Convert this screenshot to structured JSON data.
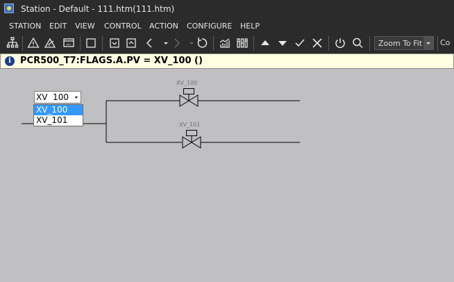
{
  "window": {
    "title": "Station - Default - 111.htm(111.htm)"
  },
  "menu": {
    "items": [
      "STATION",
      "EDIT",
      "VIEW",
      "CONTROL",
      "ACTION",
      "CONFIGURE",
      "HELP"
    ]
  },
  "toolbar": {
    "zoom_label": "Zoom To Fit",
    "cutoff_label": "Co",
    "icons": [
      "network-icon",
      "alarm-icon",
      "alarm-ack-icon",
      "message-icon",
      "square-icon",
      "checkbox-icon",
      "page-up-icon",
      "back-icon",
      "history-dropdown-icon",
      "forward-icon",
      "forward-dropdown-icon",
      "refresh-icon",
      "trend-icon",
      "group-icon",
      "raise-icon",
      "lower-icon",
      "accept-icon",
      "cancel-icon",
      "power-icon",
      "search-icon",
      "zoom-dropdown-icon"
    ]
  },
  "status": {
    "message": "PCR500_T7:FLAGS.A.PV = XV_100 ()"
  },
  "display": {
    "combo": {
      "value": "XV  100",
      "options": [
        "XV_100",
        "XV_101"
      ],
      "selected_index": 0
    },
    "valves": [
      {
        "label": "XV_100"
      },
      {
        "label": "XV_101"
      }
    ]
  }
}
